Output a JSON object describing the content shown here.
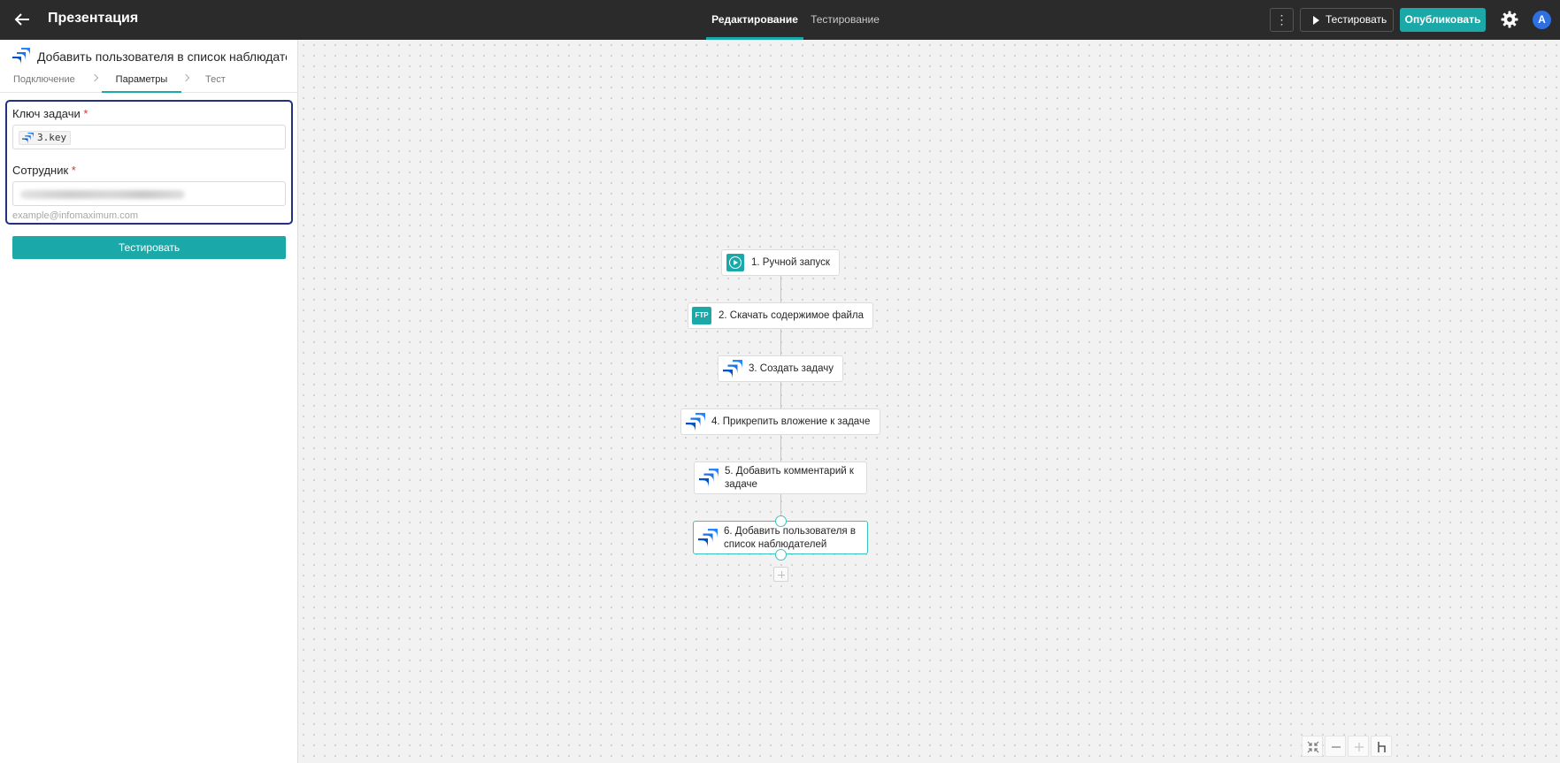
{
  "topbar": {
    "title": "Презентация",
    "tabs": [
      {
        "label": "Редактирование",
        "active": true
      },
      {
        "label": "Тестирование",
        "active": false
      }
    ],
    "more_label": "⋮",
    "test_button": "Тестировать",
    "publish_button": "Опубликовать",
    "avatar_initial": "A"
  },
  "panel": {
    "title": "Добавить пользователя в список наблюдателей",
    "steps": [
      {
        "label": "Подключение",
        "active": false
      },
      {
        "label": "Параметры",
        "active": true
      },
      {
        "label": "Тест",
        "active": false
      }
    ],
    "fields": [
      {
        "label": "Ключ задачи",
        "required_mark": "*",
        "value": "3.key"
      },
      {
        "label": "Сотрудник",
        "required_mark": "*",
        "value_blurred": true,
        "hint": "example@infomaximum.com"
      }
    ],
    "test_button": "Тестировать"
  },
  "flow": {
    "nodes": [
      {
        "label": "1. Ручной запуск",
        "icon": "play-circle-icon"
      },
      {
        "label": "2. Скачать содержимое файла",
        "icon": "ftp-icon",
        "icon_text": "FTP"
      },
      {
        "label": "3. Создать задачу",
        "icon": "jira-icon"
      },
      {
        "label": "4. Прикрепить вложение к задаче",
        "icon": "jira-icon"
      },
      {
        "label_line1": "5. Добавить комментарий к",
        "label_line2": "задаче",
        "icon": "jira-icon"
      },
      {
        "label_line1": "6. Добавить пользователя в",
        "label_line2": "список наблюдателей",
        "icon": "jira-icon",
        "selected": true
      }
    ]
  },
  "colors": {
    "accent": "#1aa9a8",
    "topbar_bg": "#2b2b2b",
    "focus_border": "#22317e",
    "required": "#e03131",
    "avatar_bg": "#2f6fe0"
  }
}
